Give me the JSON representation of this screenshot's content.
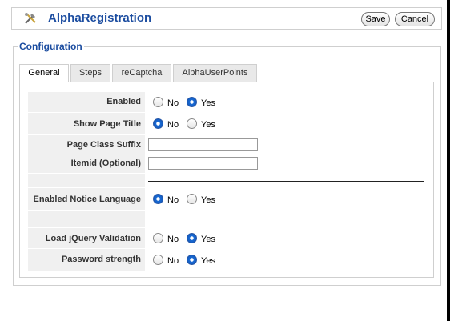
{
  "header": {
    "title": "AlphaRegistration",
    "save_label": "Save",
    "cancel_label": "Cancel",
    "icon": "tools-icon"
  },
  "fieldset": {
    "legend": "Configuration"
  },
  "tabs": [
    {
      "label": "General",
      "active": true
    },
    {
      "label": "Steps",
      "active": false
    },
    {
      "label": "reCaptcha",
      "active": false
    },
    {
      "label": "AlphaUserPoints",
      "active": false
    }
  ],
  "options": {
    "no": "No",
    "yes": "Yes"
  },
  "fields": {
    "enabled": {
      "label": "Enabled",
      "value": "Yes"
    },
    "show_page_title": {
      "label": "Show Page Title",
      "value": "No"
    },
    "page_class_suffix": {
      "label": "Page Class Suffix",
      "value": ""
    },
    "itemid": {
      "label": "Itemid (Optional)",
      "value": ""
    },
    "enabled_notice_language": {
      "label": "Enabled Notice Language",
      "value": "No"
    },
    "load_jquery_validation": {
      "label": "Load jQuery Validation",
      "value": "Yes"
    },
    "password_strength": {
      "label": "Password strength",
      "value": "Yes"
    }
  }
}
